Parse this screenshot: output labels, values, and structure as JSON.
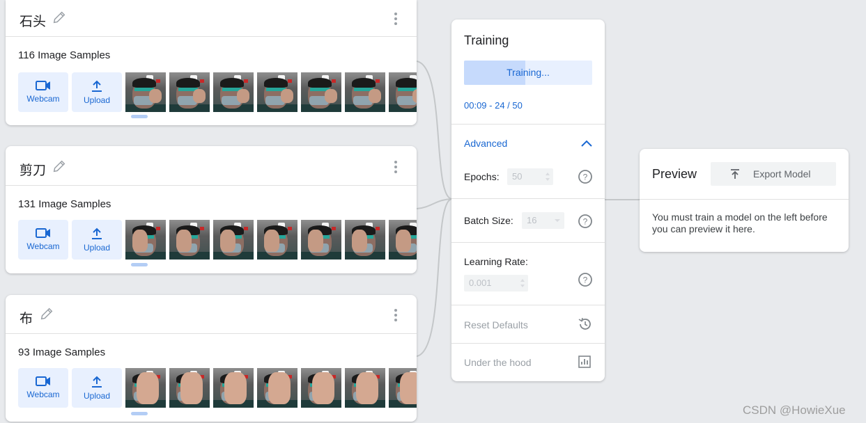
{
  "classes": [
    {
      "name": "石头",
      "samples": "116 Image Samples",
      "gesture": "fist"
    },
    {
      "name": "剪刀",
      "samples": "131 Image Samples",
      "gesture": "v"
    },
    {
      "name": "布",
      "samples": "93 Image Samples",
      "gesture": "palm"
    }
  ],
  "buttons": {
    "webcam": "Webcam",
    "upload": "Upload"
  },
  "training": {
    "title": "Training",
    "button_label": "Training...",
    "progress_fraction": 0.48,
    "status": "00:09 - 24 / 50",
    "advanced_label": "Advanced",
    "epochs_label": "Epochs:",
    "epochs_value": "50",
    "batch_label": "Batch Size:",
    "batch_value": "16",
    "lr_label": "Learning Rate:",
    "lr_value": "0.001",
    "reset_label": "Reset Defaults",
    "hood_label": "Under the hood"
  },
  "preview": {
    "title": "Preview",
    "export_label": "Export Model",
    "message": "You must train a model on the left before you can preview it here."
  },
  "watermark": "CSDN @HowieXue",
  "colors": {
    "accent": "#1967d2",
    "accent_light": "#e8f0fe",
    "background": "#e8eaed"
  }
}
